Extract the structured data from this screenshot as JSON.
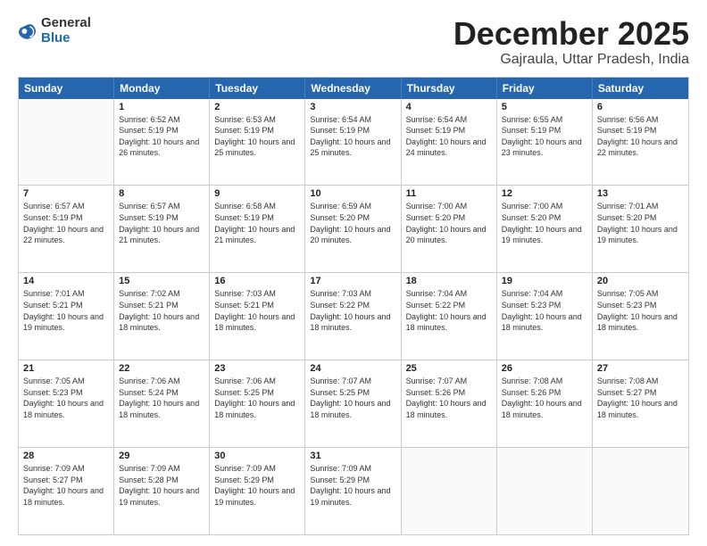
{
  "logo": {
    "general": "General",
    "blue": "Blue"
  },
  "title": {
    "month": "December 2025",
    "location": "Gajraula, Uttar Pradesh, India"
  },
  "header_days": [
    "Sunday",
    "Monday",
    "Tuesday",
    "Wednesday",
    "Thursday",
    "Friday",
    "Saturday"
  ],
  "weeks": [
    [
      {
        "date": "",
        "sunrise": "",
        "sunset": "",
        "daylight": ""
      },
      {
        "date": "1",
        "sunrise": "6:52 AM",
        "sunset": "5:19 PM",
        "daylight": "10 hours and 26 minutes."
      },
      {
        "date": "2",
        "sunrise": "6:53 AM",
        "sunset": "5:19 PM",
        "daylight": "10 hours and 25 minutes."
      },
      {
        "date": "3",
        "sunrise": "6:54 AM",
        "sunset": "5:19 PM",
        "daylight": "10 hours and 25 minutes."
      },
      {
        "date": "4",
        "sunrise": "6:54 AM",
        "sunset": "5:19 PM",
        "daylight": "10 hours and 24 minutes."
      },
      {
        "date": "5",
        "sunrise": "6:55 AM",
        "sunset": "5:19 PM",
        "daylight": "10 hours and 23 minutes."
      },
      {
        "date": "6",
        "sunrise": "6:56 AM",
        "sunset": "5:19 PM",
        "daylight": "10 hours and 22 minutes."
      }
    ],
    [
      {
        "date": "7",
        "sunrise": "6:57 AM",
        "sunset": "5:19 PM",
        "daylight": "10 hours and 22 minutes."
      },
      {
        "date": "8",
        "sunrise": "6:57 AM",
        "sunset": "5:19 PM",
        "daylight": "10 hours and 21 minutes."
      },
      {
        "date": "9",
        "sunrise": "6:58 AM",
        "sunset": "5:19 PM",
        "daylight": "10 hours and 21 minutes."
      },
      {
        "date": "10",
        "sunrise": "6:59 AM",
        "sunset": "5:20 PM",
        "daylight": "10 hours and 20 minutes."
      },
      {
        "date": "11",
        "sunrise": "7:00 AM",
        "sunset": "5:20 PM",
        "daylight": "10 hours and 20 minutes."
      },
      {
        "date": "12",
        "sunrise": "7:00 AM",
        "sunset": "5:20 PM",
        "daylight": "10 hours and 19 minutes."
      },
      {
        "date": "13",
        "sunrise": "7:01 AM",
        "sunset": "5:20 PM",
        "daylight": "10 hours and 19 minutes."
      }
    ],
    [
      {
        "date": "14",
        "sunrise": "7:01 AM",
        "sunset": "5:21 PM",
        "daylight": "10 hours and 19 minutes."
      },
      {
        "date": "15",
        "sunrise": "7:02 AM",
        "sunset": "5:21 PM",
        "daylight": "10 hours and 18 minutes."
      },
      {
        "date": "16",
        "sunrise": "7:03 AM",
        "sunset": "5:21 PM",
        "daylight": "10 hours and 18 minutes."
      },
      {
        "date": "17",
        "sunrise": "7:03 AM",
        "sunset": "5:22 PM",
        "daylight": "10 hours and 18 minutes."
      },
      {
        "date": "18",
        "sunrise": "7:04 AM",
        "sunset": "5:22 PM",
        "daylight": "10 hours and 18 minutes."
      },
      {
        "date": "19",
        "sunrise": "7:04 AM",
        "sunset": "5:23 PM",
        "daylight": "10 hours and 18 minutes."
      },
      {
        "date": "20",
        "sunrise": "7:05 AM",
        "sunset": "5:23 PM",
        "daylight": "10 hours and 18 minutes."
      }
    ],
    [
      {
        "date": "21",
        "sunrise": "7:05 AM",
        "sunset": "5:23 PM",
        "daylight": "10 hours and 18 minutes."
      },
      {
        "date": "22",
        "sunrise": "7:06 AM",
        "sunset": "5:24 PM",
        "daylight": "10 hours and 18 minutes."
      },
      {
        "date": "23",
        "sunrise": "7:06 AM",
        "sunset": "5:25 PM",
        "daylight": "10 hours and 18 minutes."
      },
      {
        "date": "24",
        "sunrise": "7:07 AM",
        "sunset": "5:25 PM",
        "daylight": "10 hours and 18 minutes."
      },
      {
        "date": "25",
        "sunrise": "7:07 AM",
        "sunset": "5:26 PM",
        "daylight": "10 hours and 18 minutes."
      },
      {
        "date": "26",
        "sunrise": "7:08 AM",
        "sunset": "5:26 PM",
        "daylight": "10 hours and 18 minutes."
      },
      {
        "date": "27",
        "sunrise": "7:08 AM",
        "sunset": "5:27 PM",
        "daylight": "10 hours and 18 minutes."
      }
    ],
    [
      {
        "date": "28",
        "sunrise": "7:09 AM",
        "sunset": "5:27 PM",
        "daylight": "10 hours and 18 minutes."
      },
      {
        "date": "29",
        "sunrise": "7:09 AM",
        "sunset": "5:28 PM",
        "daylight": "10 hours and 19 minutes."
      },
      {
        "date": "30",
        "sunrise": "7:09 AM",
        "sunset": "5:29 PM",
        "daylight": "10 hours and 19 minutes."
      },
      {
        "date": "31",
        "sunrise": "7:09 AM",
        "sunset": "5:29 PM",
        "daylight": "10 hours and 19 minutes."
      },
      {
        "date": "",
        "sunrise": "",
        "sunset": "",
        "daylight": ""
      },
      {
        "date": "",
        "sunrise": "",
        "sunset": "",
        "daylight": ""
      },
      {
        "date": "",
        "sunrise": "",
        "sunset": "",
        "daylight": ""
      }
    ]
  ]
}
